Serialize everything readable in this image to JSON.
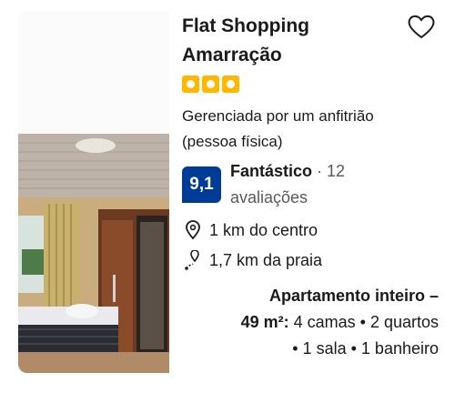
{
  "property": {
    "name_line1": "Flat Shopping",
    "name_line2": "Amarração",
    "star_rating": 3,
    "host_type_line1": "Gerenciada por um anfitrião",
    "host_type_line2": "(pessoa física)",
    "review_score": "9,1",
    "review_word": "Fantástico",
    "review_separator": " · ",
    "review_count": "12",
    "review_count_label": "avaliações",
    "distance_center": "1 km do centro",
    "distance_beach": "1,7 km da praia",
    "unit_type": "Apartamento inteiro –",
    "unit_size": "49 m²:",
    "unit_details_1": " 4 camas • 2 quartos",
    "unit_details_2": "• 1 sala • 1 banheiro"
  },
  "icons": {
    "favorite": "heart-outline-icon",
    "location": "map-pin-icon",
    "beach": "beach-route-icon",
    "star": "square-star-icon"
  },
  "colors": {
    "score_bg": "#003b95",
    "star": "#ffb700"
  }
}
